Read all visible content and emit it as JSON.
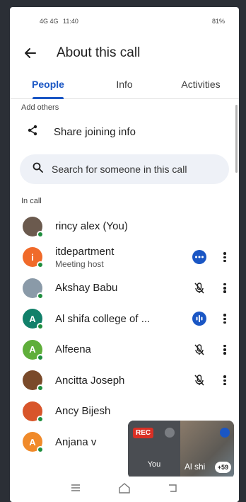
{
  "status_bar": {
    "time": "11:40",
    "signal_left": "4G 4G",
    "right": "81%"
  },
  "app_bar": {
    "title": "About this call"
  },
  "tabs": [
    {
      "label": "People",
      "active": true
    },
    {
      "label": "Info",
      "active": false
    },
    {
      "label": "Activities",
      "active": false
    }
  ],
  "add_others": {
    "heading": "Add others",
    "share_label": "Share joining info"
  },
  "search": {
    "placeholder": "Search for someone in this call"
  },
  "in_call": {
    "heading": "In call",
    "participants": [
      {
        "name": "rincy alex (You)",
        "subtitle": "",
        "avatar_color": "#6b5a4e",
        "initial": "",
        "action": "none"
      },
      {
        "name": "itdepartment",
        "subtitle": "Meeting host",
        "avatar_color": "#f06a2a",
        "initial": "i",
        "action": "more-options-badge"
      },
      {
        "name": "Akshay Babu",
        "subtitle": "",
        "avatar_color": "#8a9aa8",
        "initial": "",
        "action": "mic-off"
      },
      {
        "name": "Al shifa college of ...",
        "subtitle": "",
        "avatar_color": "#12806a",
        "initial": "A",
        "action": "speaking"
      },
      {
        "name": "Alfeena",
        "subtitle": "",
        "avatar_color": "#5fae3a",
        "initial": "A",
        "action": "mic-off"
      },
      {
        "name": "Ancitta Joseph",
        "subtitle": "",
        "avatar_color": "#7a4a2a",
        "initial": "",
        "action": "mic-off"
      },
      {
        "name": "Ancy Bijesh",
        "subtitle": "",
        "avatar_color": "#d8552a",
        "initial": "",
        "action": "none"
      },
      {
        "name": "Anjana v",
        "subtitle": "",
        "avatar_color": "#f08a2a",
        "initial": "A",
        "action": "none"
      }
    ]
  },
  "pip": {
    "rec_label": "REC",
    "self_label": "You",
    "other_label": "Al shi",
    "more_count": "+59"
  },
  "colors": {
    "accent": "#1a56c4",
    "online": "#1e8e3e",
    "rec": "#d93025"
  }
}
